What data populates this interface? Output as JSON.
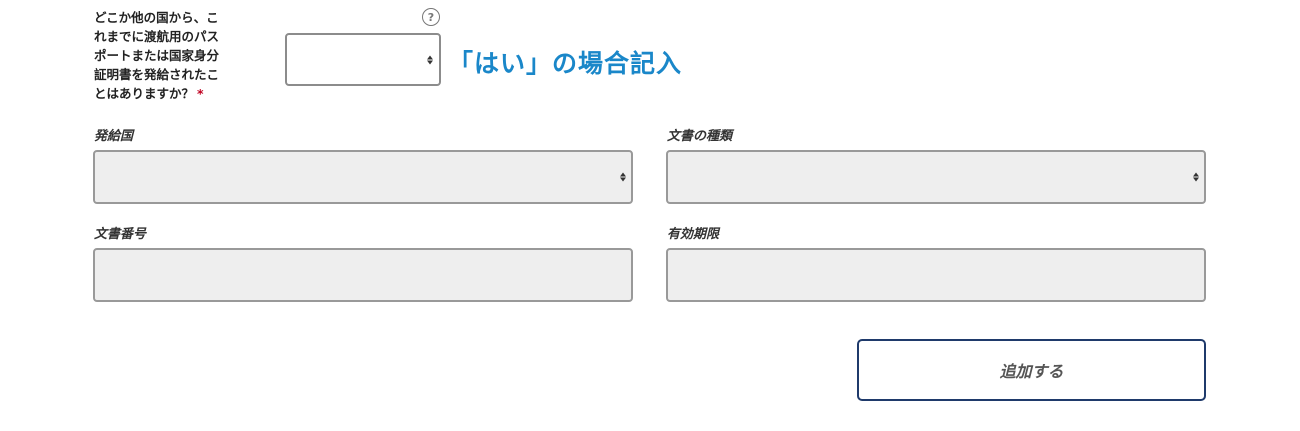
{
  "question": {
    "lines": [
      "どこか他の国から、こ",
      "れまでに渡航用のパス",
      "ポートまたは国家身分",
      "証明書を発給されたこ",
      "とはありますか？"
    ],
    "required_mark": "*",
    "help_icon": "question-circle-icon",
    "select_value": ""
  },
  "annotation": {
    "text": "「はい」の場合記入",
    "color": "#1a87c9"
  },
  "fields": {
    "issuing_country": {
      "label": "発給国",
      "value": ""
    },
    "document_type": {
      "label": "文書の種類",
      "value": ""
    },
    "document_number": {
      "label": "文書番号",
      "value": ""
    },
    "expiry_date": {
      "label": "有効期限",
      "value": ""
    }
  },
  "add_button": {
    "label": "追加する",
    "border_color": "#1f3a6b"
  }
}
